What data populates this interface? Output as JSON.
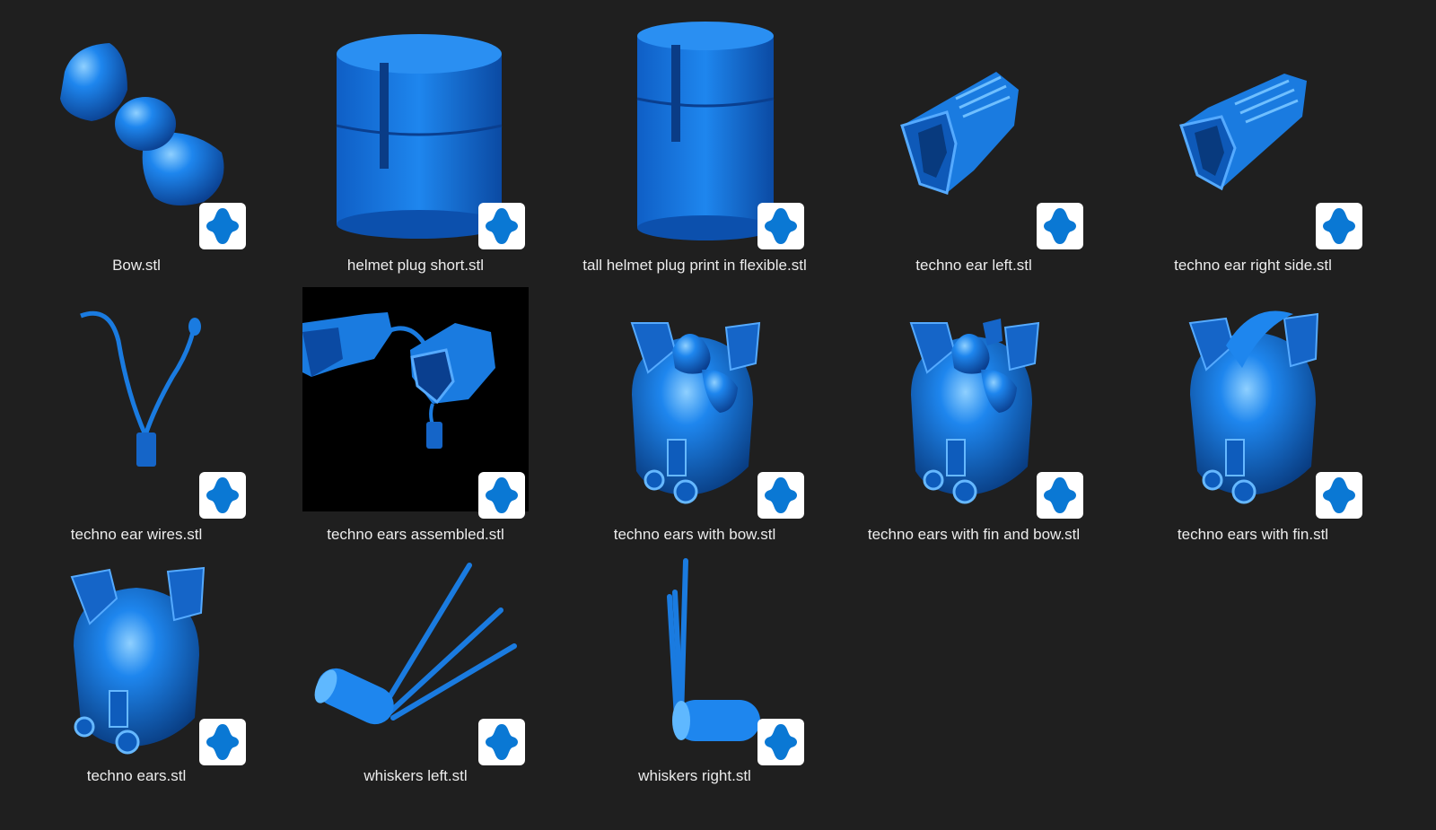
{
  "files": [
    {
      "label": "Bow.stl",
      "thumbnail": "bow"
    },
    {
      "label": "helmet plug short.stl",
      "thumbnail": "plug-short"
    },
    {
      "label": "tall helmet plug print in flexible.stl",
      "thumbnail": "plug-tall"
    },
    {
      "label": "techno ear left.stl",
      "thumbnail": "ear-left"
    },
    {
      "label": "techno ear right side.stl",
      "thumbnail": "ear-right"
    },
    {
      "label": "techno ear wires.stl",
      "thumbnail": "wires"
    },
    {
      "label": "techno ears assembled.stl",
      "thumbnail": "assembled"
    },
    {
      "label": "techno ears with bow.stl",
      "thumbnail": "helmet-bow"
    },
    {
      "label": "techno ears with fin and bow.stl",
      "thumbnail": "helmet-fin-bow"
    },
    {
      "label": "techno ears with fin.stl",
      "thumbnail": "helmet-fin"
    },
    {
      "label": "techno ears.stl",
      "thumbnail": "helmet"
    },
    {
      "label": "whiskers left.stl",
      "thumbnail": "whiskers-left"
    },
    {
      "label": "whiskers right.stl",
      "thumbnail": "whiskers-right"
    }
  ],
  "app_badge_icon": "3d-viewer-icon",
  "colors": {
    "background": "#1f1f1f",
    "model_blue": "#1e7be0",
    "badge_blue": "#0a78d4"
  }
}
